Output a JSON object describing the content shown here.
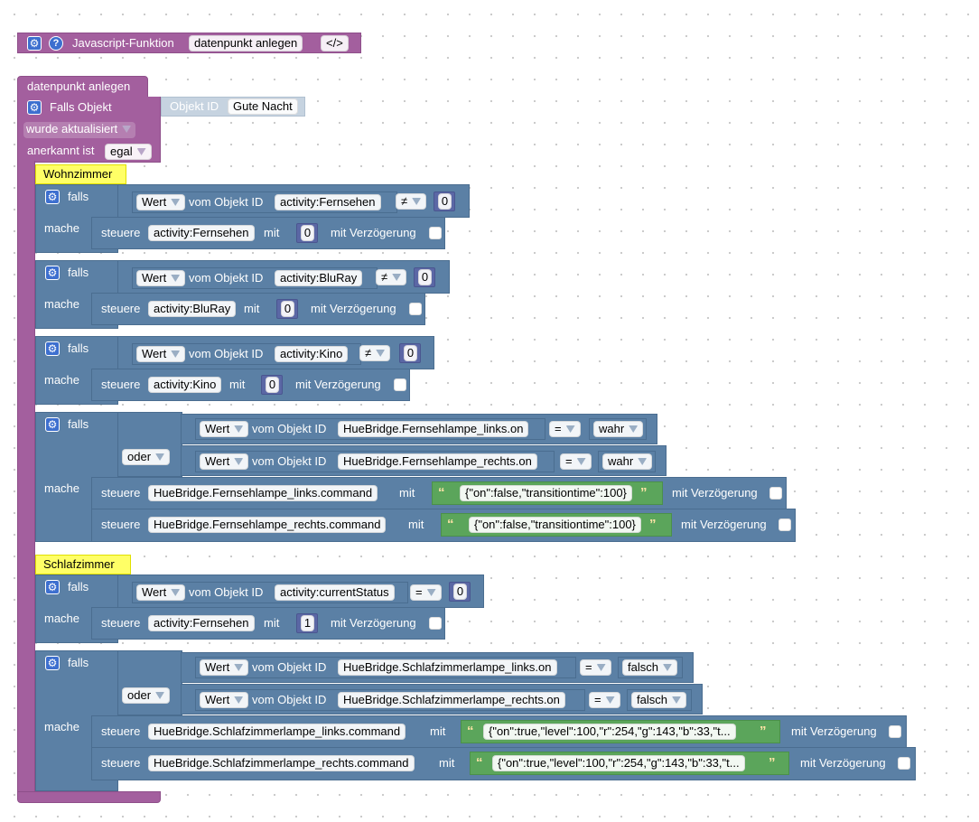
{
  "header": {
    "title": "Javascript-Funktion",
    "name": "datenpunkt anlegen",
    "code_icon": "</>"
  },
  "trigger": {
    "function_label": "datenpunkt anlegen",
    "falls_objekt": "Falls Objekt",
    "objekt_id_label": "Objekt ID",
    "objekt_id_value": "Gute Nacht",
    "wurde": "wurde aktualisiert",
    "anerkannt_label": "anerkannt ist",
    "anerkannt_value": "egal"
  },
  "labels": {
    "falls": "falls",
    "mache": "mache",
    "oder": "oder",
    "wert": "Wert",
    "vom_objekt": "vom Objekt ID",
    "steuere": "steuere",
    "mit": "mit",
    "mit_verz": "mit Verzögerung"
  },
  "comments": {
    "wohnzimmer": "Wohnzimmer",
    "schlafzimmer": "Schlafzimmer"
  },
  "ops": {
    "neq": "≠",
    "eq": "="
  },
  "nums": {
    "zero": "0",
    "one": "1"
  },
  "bools": {
    "wahr": "wahr",
    "falsch": "falsch"
  },
  "objects": {
    "fernsehen": "activity:Fernsehen",
    "bluray": "activity:BluRay",
    "kino": "activity:Kino",
    "current": "activity:currentStatus",
    "fl_on": "HueBridge.Fernsehlampe_links.on",
    "fr_on": "HueBridge.Fernsehlampe_rechts.on",
    "fl_cmd": "HueBridge.Fernsehlampe_links.command",
    "fr_cmd": "HueBridge.Fernsehlampe_rechts.command",
    "sl_on": "HueBridge.Schlafzimmerlampe_links.on",
    "sr_on": "HueBridge.Schlafzimmerlampe_rechts.on",
    "sl_cmd": "HueBridge.Schlafzimmerlampe_links.command",
    "sr_cmd": "HueBridge.Schlafzimmerlampe_rechts.command"
  },
  "strings": {
    "off": "{\"on\":false,\"transitiontime\":100}",
    "on": "{\"on\":true,\"level\":100,\"r\":254,\"g\":143,\"b\":33,\"t..."
  },
  "colors": {
    "event": "#a35f9e",
    "logic": "#5b80a5",
    "text": "#5ba55b",
    "comment": "#ffff66",
    "math": "#5b67a5"
  }
}
